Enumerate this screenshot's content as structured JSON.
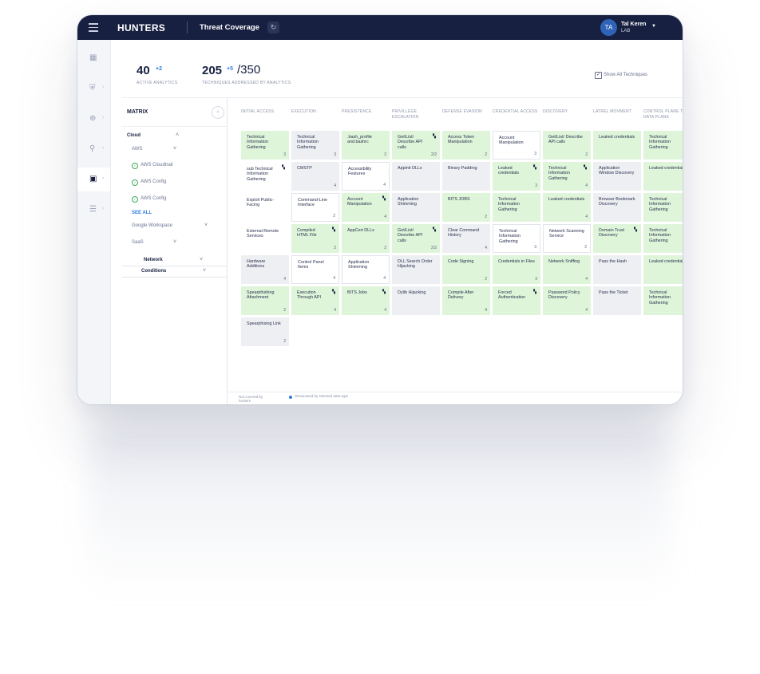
{
  "app": {
    "brand": "HUNTERS",
    "page_title": "Threat Coverage",
    "user_initials": "TA",
    "user_name": "Tal Keren",
    "user_org": "LAB"
  },
  "stats": {
    "active_analytics": "40",
    "active_delta": "+2",
    "active_label": "ACTIVE ANALYTICS",
    "techniques": "205",
    "techniques_delta": "+5",
    "techniques_total": "/350",
    "techniques_label": "TECHNIQUES ADDRESSED BY ANALYTICS",
    "show_all_label": "Show All Techniques",
    "show_all_checked": true
  },
  "left_panel": {
    "title": "MATRIX",
    "cloud": "Cloud",
    "aws": "AWS",
    "aws_items": [
      "AWS Cloudtrail",
      "AWS Config",
      "AWS Config"
    ],
    "see_all": "SEE ALL",
    "google": "Google Workspace",
    "saas": "SaaS",
    "network": "Network",
    "conditions": "Conditions"
  },
  "matrix": {
    "columns": [
      "INITIAL ACCESS",
      "EXECUTION",
      "PRESISTENCE",
      "PRIVILLEGE ESCALATION",
      "DEFENSE EVASION",
      "CREDENTIAL ACCESS",
      "DISCOVERY",
      "LATREL MOVMENT",
      "CONTROL PLANE TO DATA PLANE"
    ],
    "tiles": [
      [
        {
          "label": "Technical Information Gathering",
          "count": "3",
          "state": "green"
        },
        {
          "label": "sub Technical Information Gathering",
          "count": "",
          "state": "noncovered",
          "flag": true
        },
        {
          "label": "Exploit Public-Facing",
          "count": "",
          "state": "noncovered"
        },
        {
          "label": "External Remote Services",
          "count": "",
          "state": "noncovered"
        },
        {
          "label": "Hardware Additions",
          "count": "4",
          "state": "grey"
        },
        {
          "label": "Spearphishing Attachment",
          "count": "2",
          "state": "green"
        },
        {
          "label": "Spearphising Link",
          "count": "2",
          "state": "grey"
        }
      ],
      [
        {
          "label": "Technical Information Gathering",
          "count": "3",
          "state": "grey"
        },
        {
          "label": "CMSTP",
          "count": "4",
          "state": "grey"
        },
        {
          "label": "Command-Line Interface",
          "count": "2",
          "state": "white"
        },
        {
          "label": "Compiled HTML File",
          "count": "2",
          "state": "green",
          "flag": true
        },
        {
          "label": "Control Panel Items",
          "count": "4",
          "state": "white"
        },
        {
          "label": "Execution Through API",
          "count": "4",
          "state": "green",
          "flag": true
        }
      ],
      [
        {
          "label": ".bash_profile and.bashrc",
          "count": "2",
          "state": "green"
        },
        {
          "label": "Accessibility Features",
          "count": "4",
          "state": "white"
        },
        {
          "label": "Account Manipulation",
          "count": "4",
          "state": "green",
          "flag": true
        },
        {
          "label": "AppCert DLLs",
          "count": "2",
          "state": "green"
        },
        {
          "label": "Application Shimming",
          "count": "4",
          "state": "white"
        },
        {
          "label": "BITS Jobs",
          "count": "4",
          "state": "green",
          "flag": true
        }
      ],
      [
        {
          "label": "Get/List/ Describe API calls",
          "count": "2/2",
          "state": "green",
          "flag": true
        },
        {
          "label": "Appinit DLLs",
          "count": "",
          "state": "grey"
        },
        {
          "label": "Application Shimming",
          "count": "",
          "state": "grey"
        },
        {
          "label": "Get/List/ Describe API calls",
          "count": "2/2",
          "state": "green",
          "flag": true
        },
        {
          "label": "DLL Search Order Hijacking",
          "count": "",
          "state": "grey"
        },
        {
          "label": "Dylib Hijacking",
          "count": "",
          "state": "grey"
        }
      ],
      [
        {
          "label": "Access Token Manipulation",
          "count": "2",
          "state": "green"
        },
        {
          "label": "Binary Padding",
          "count": "",
          "state": "grey"
        },
        {
          "label": "BITS JOBS",
          "count": "2",
          "state": "green"
        },
        {
          "label": "Clear Command History",
          "count": "4",
          "state": "grey"
        },
        {
          "label": "Code Signing",
          "count": "2",
          "state": "green"
        },
        {
          "label": "Compile After Delivery",
          "count": "4",
          "state": "green"
        }
      ],
      [
        {
          "label": "Account Manipulation",
          "count": "3",
          "state": "white"
        },
        {
          "label": "Leaked credentials",
          "count": "3",
          "state": "green",
          "flag": true
        },
        {
          "label": "Technical Information Gathering",
          "count": "",
          "state": "green"
        },
        {
          "label": "Technical Information Gathering",
          "count": "3",
          "state": "white"
        },
        {
          "label": "Credentials in Files",
          "count": "3",
          "state": "green"
        },
        {
          "label": "Forced Authentication",
          "count": "",
          "state": "green",
          "flag": true
        }
      ],
      [
        {
          "label": "Get/List/ Describe API calls",
          "count": "2",
          "state": "green"
        },
        {
          "label": "Technical Information Gathering",
          "count": "4",
          "state": "green",
          "flag": true
        },
        {
          "label": "Leaked credentials",
          "count": "4",
          "state": "green"
        },
        {
          "label": "Network Scanning Service",
          "count": "2",
          "state": "white"
        },
        {
          "label": "Network Sniffing",
          "count": "4",
          "state": "green"
        },
        {
          "label": "Password Policy Discovery",
          "count": "4",
          "state": "green"
        }
      ],
      [
        {
          "label": "Leaked credentials",
          "count": "",
          "state": "green"
        },
        {
          "label": "Application Window Discovery",
          "count": "",
          "state": "grey"
        },
        {
          "label": "Browser Bookmark Discovery",
          "count": "",
          "state": "grey"
        },
        {
          "label": "Domain Trust Discovery",
          "count": "",
          "state": "green",
          "flag": true
        },
        {
          "label": "Pass the Hash",
          "count": "",
          "state": "grey"
        },
        {
          "label": "Pass the Ticket",
          "count": "",
          "state": "grey"
        }
      ],
      [
        {
          "label": "Technical Information Gathering",
          "count": "",
          "state": "green"
        },
        {
          "label": "Leaked credentials",
          "count": "",
          "state": "green"
        },
        {
          "label": "Technical Information Gathering",
          "count": "",
          "state": "green"
        },
        {
          "label": "Technical Information Gathering",
          "count": "",
          "state": "green"
        },
        {
          "label": "Leaked credentials",
          "count": "",
          "state": "green"
        },
        {
          "label": "Technical Information Gathering",
          "count": "",
          "state": "green"
        }
      ]
    ]
  },
  "legend": {
    "not_covered": "Not covered by hunters",
    "showcased": "Showcased by selected data type"
  }
}
